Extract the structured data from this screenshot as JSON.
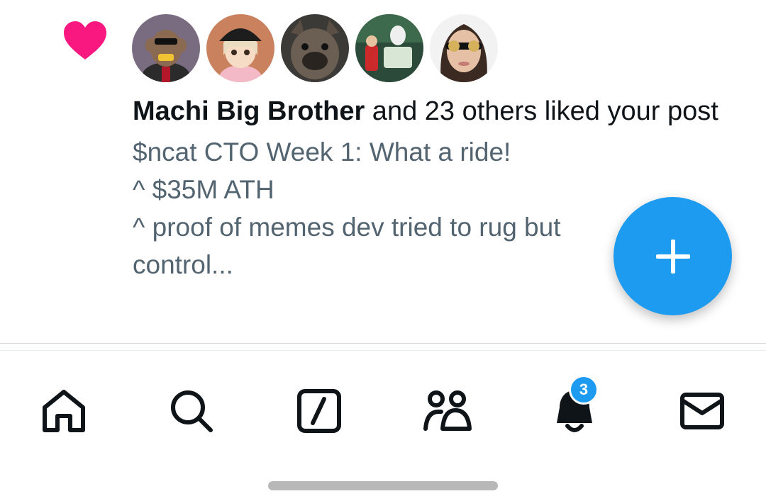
{
  "notification": {
    "type_icon": "heart-icon",
    "liker_name": "Machi Big Brother",
    "liked_text": " and 23 others liked your post",
    "avatars": [
      {
        "icon": "ape-avatar"
      },
      {
        "icon": "anime-girl-avatar"
      },
      {
        "icon": "bulldog-avatar"
      },
      {
        "icon": "et-movie-avatar"
      },
      {
        "icon": "woman-coins-eyes-avatar"
      }
    ],
    "preview_lines": [
      "$ncat CTO Week 1: What a ride!",
      "^ $35M ATH",
      "^ proof of memes dev tried to rug but",
      "control..."
    ]
  },
  "fab": {
    "icon": "plus-icon",
    "label": "+"
  },
  "tabbar": {
    "items": [
      {
        "name": "home",
        "icon": "home-icon"
      },
      {
        "name": "search",
        "icon": "search-icon"
      },
      {
        "name": "grok",
        "icon": "grok-icon"
      },
      {
        "name": "communities",
        "icon": "communities-icon"
      },
      {
        "name": "notifications",
        "icon": "bell-icon",
        "badge": "3"
      },
      {
        "name": "messages",
        "icon": "mail-icon"
      }
    ]
  },
  "colors": {
    "accent": "#1d9bf0",
    "heart": "#f91880",
    "text_primary": "#0f1419",
    "text_secondary": "#536471"
  }
}
